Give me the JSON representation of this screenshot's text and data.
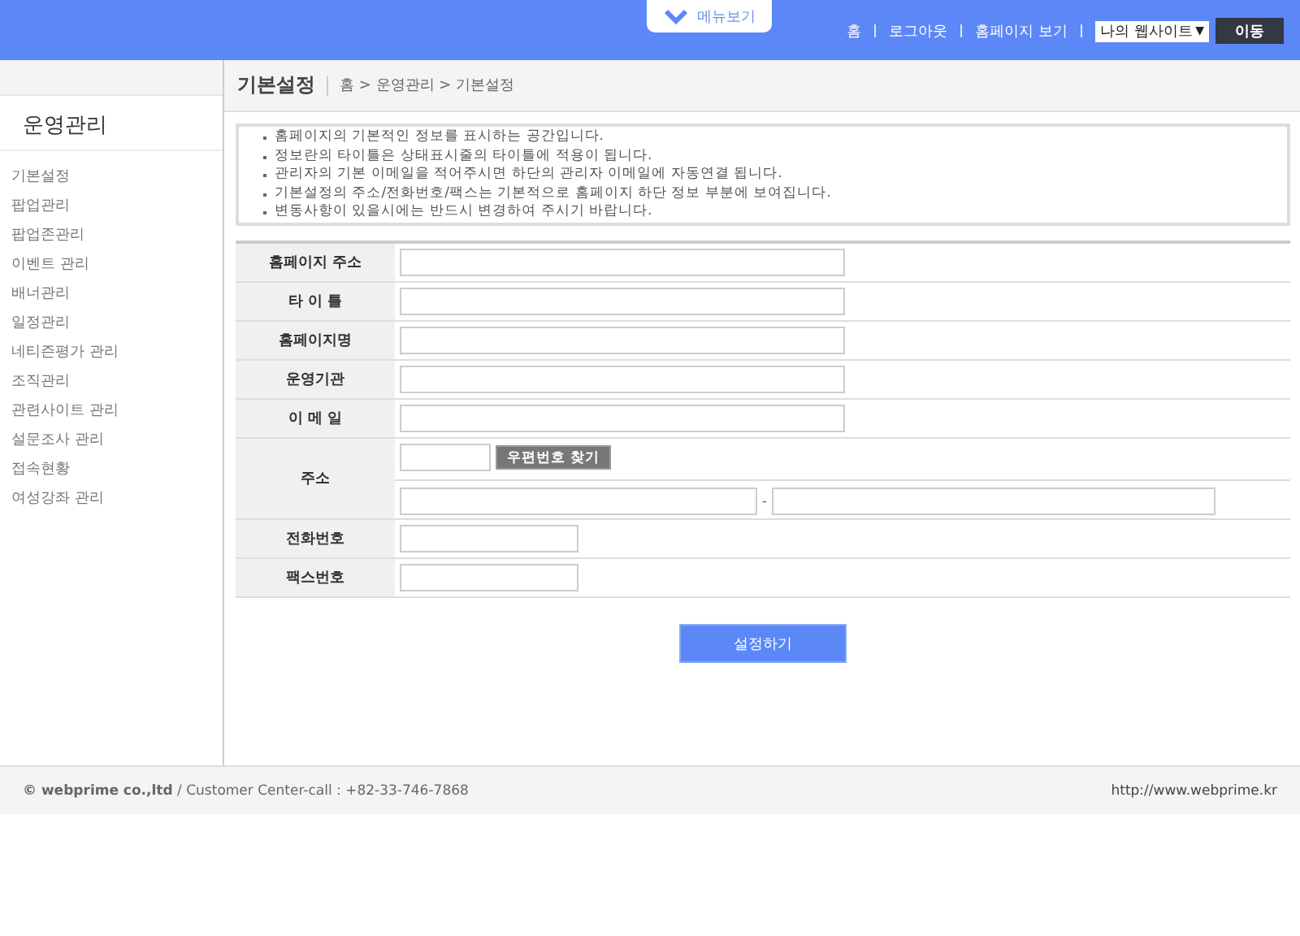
{
  "header": {
    "menu_button": "메뉴보기",
    "links": [
      "홈",
      "로그아웃",
      "홈페이지 보기"
    ],
    "site_select": {
      "value": "나의 웹사이트",
      "arrow": "▼"
    },
    "go_button": "이동"
  },
  "sidebar": {
    "title": "운영관리",
    "items": [
      {
        "label": "기본설정"
      },
      {
        "label": "팝업관리"
      },
      {
        "label": "팝업존관리"
      },
      {
        "label": "이벤트 관리"
      },
      {
        "label": "배너관리"
      },
      {
        "label": "일정관리"
      },
      {
        "label": "네티즌평가 관리"
      },
      {
        "label": "조직관리"
      },
      {
        "label": "관련사이트 관리"
      },
      {
        "label": "설문조사 관리"
      },
      {
        "label": "접속현황"
      },
      {
        "label": "여성강좌 관리"
      }
    ]
  },
  "page": {
    "title": "기본설정",
    "breadcrumb": "홈 > 운영관리 > 기본설정"
  },
  "notices": [
    "홈페이지의 기본적인 정보를 표시하는 공간입니다.",
    "정보란의 타이틀은 상태표시줄의 타이틀에 적용이 됩니다.",
    "관리자의 기본 이메일을 적어주시면 하단의 관리자 이메일에 자동연결 됩니다.",
    "기본설정의 주소/전화번호/팩스는 기본적으로 홈페이지 하단 정보 부분에 보여집니다.",
    "변동사항이 있을시에는 반드시 변경하여 주시기 바랍니다."
  ],
  "form": [
    {
      "label": "홈페이지 주소",
      "kind": "wide"
    },
    {
      "label": "타 이 틀",
      "kind": "wide"
    },
    {
      "label": "홈페이지명",
      "kind": "wide"
    },
    {
      "label": "운영기관",
      "kind": "wide"
    },
    {
      "label": "이 메 일",
      "kind": "wide"
    },
    {
      "label": "주소",
      "kind": "address",
      "button": "우편번호 찾기",
      "separator": "-"
    },
    {
      "label": "전화번호",
      "kind": "short"
    },
    {
      "label": "팩스번호",
      "kind": "short"
    }
  ],
  "submit_button": "설정하기",
  "footer": {
    "copyright": "**© webprime co.,ltd** / Customer Center-call : +82-33-746-7868",
    "url": "http://www.webprime.kr"
  }
}
